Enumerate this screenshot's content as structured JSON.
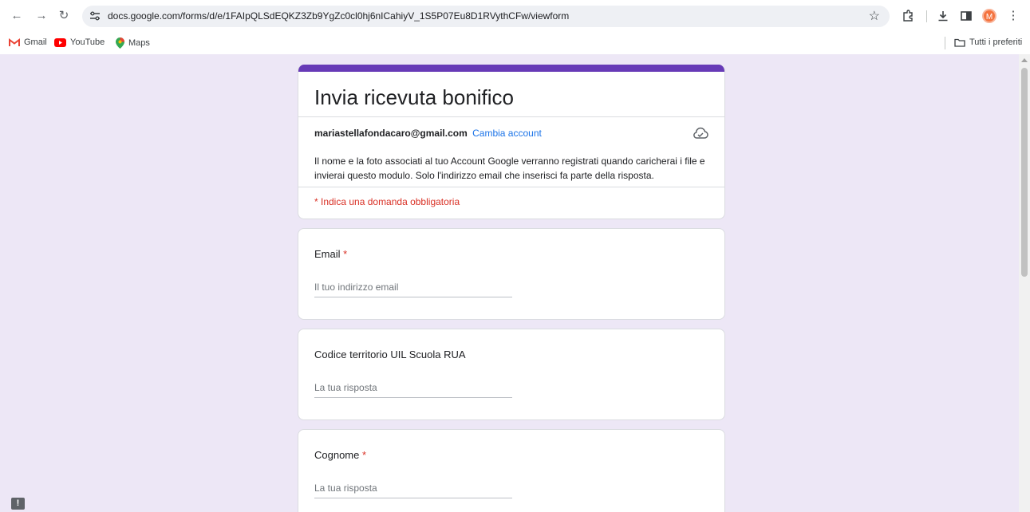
{
  "browser": {
    "url": "docs.google.com/forms/d/e/1FAIpQLSdEQKZ3Zb9YgZc0cl0hj6nICahiyV_1S5P07Eu8D1RVythCFw/viewform",
    "profile_initial": "M",
    "accent_color": "#f4733f"
  },
  "bookmarks": {
    "items": [
      {
        "label": "Gmail",
        "icon": "gmail-icon"
      },
      {
        "label": "YouTube",
        "icon": "youtube-icon"
      },
      {
        "label": "Maps",
        "icon": "maps-icon"
      }
    ],
    "all_bookmarks_label": "Tutti i preferiti"
  },
  "form": {
    "theme_color": "#673ab7",
    "title": "Invia ricevuta bonifico",
    "account_email": "mariastellafondacaro@gmail.com",
    "change_account_label": "Cambia account",
    "notice": "Il nome e la foto associati al tuo Account Google verranno registrati quando caricherai i file e invierai questo modulo. Solo l'indirizzo email che inserisci fa parte della risposta.",
    "required_note": "* Indica una domanda obbligatoria",
    "questions": [
      {
        "label": "Email",
        "required_mark": "*",
        "placeholder": "Il tuo indirizzo email"
      },
      {
        "label": "Codice territorio UIL Scuola RUA",
        "required_mark": "",
        "placeholder": "La tua risposta"
      },
      {
        "label": "Cognome",
        "required_mark": "*",
        "placeholder": "La tua risposta"
      }
    ]
  }
}
